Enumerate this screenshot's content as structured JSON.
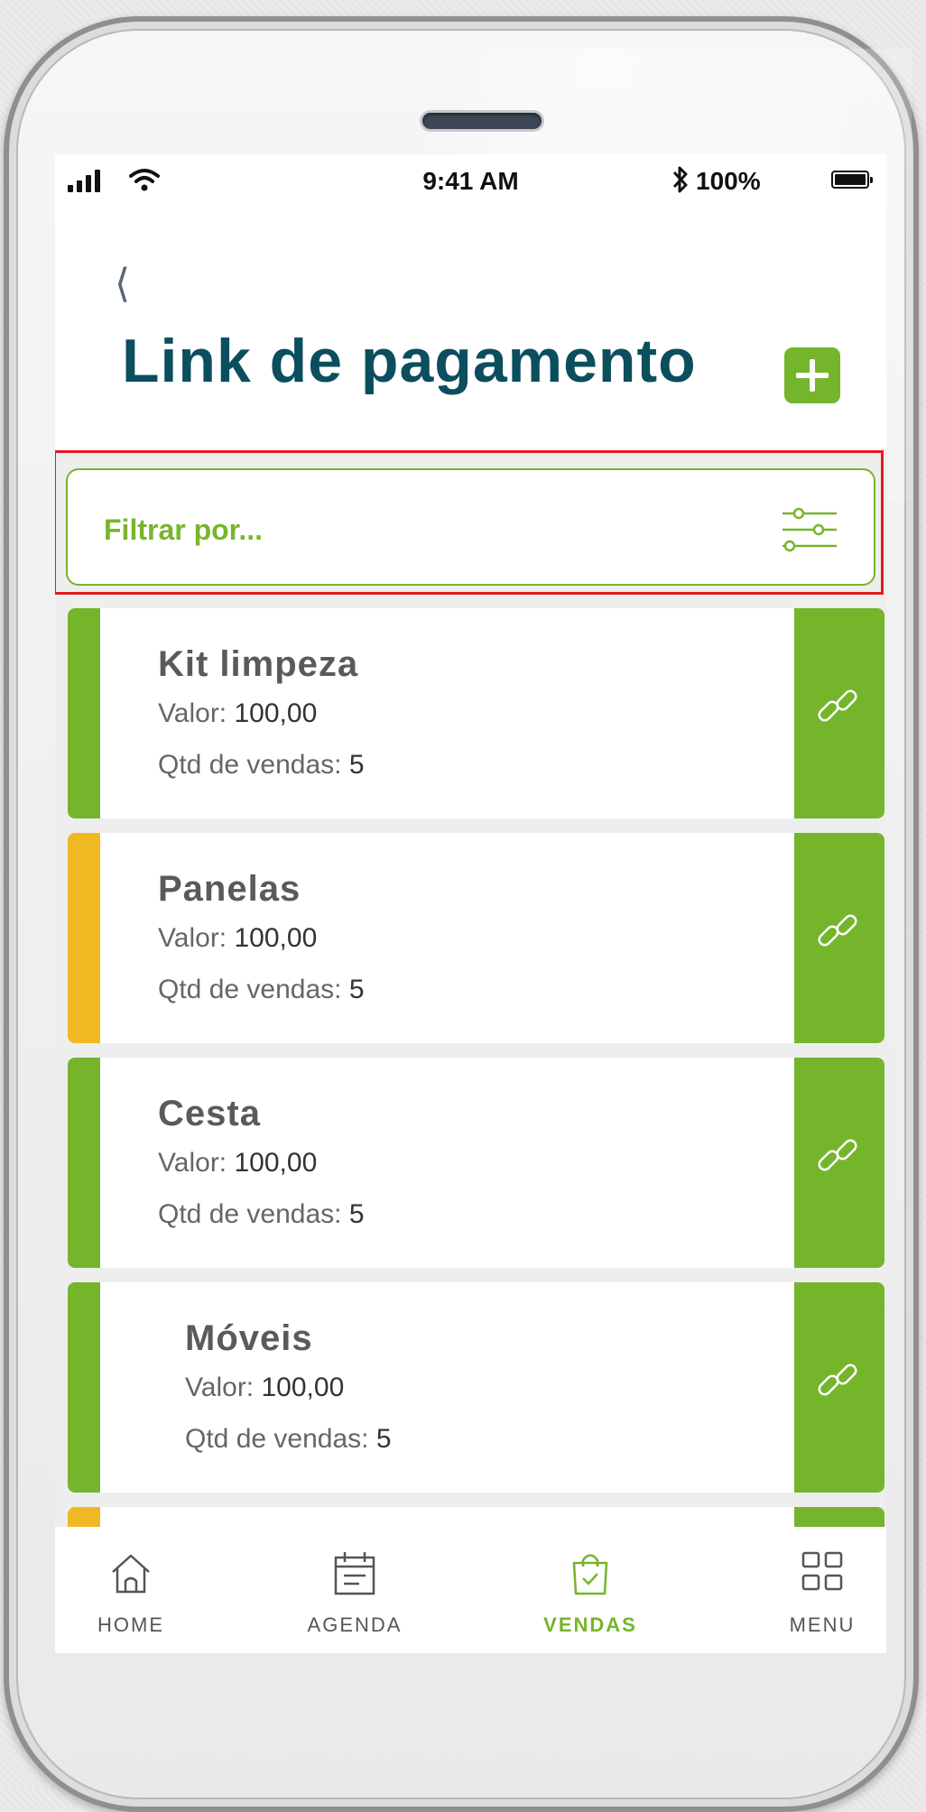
{
  "status_bar": {
    "time": "9:41 AM",
    "battery": "100%"
  },
  "header": {
    "back_icon": "chevron-left-icon",
    "title": "Link de pagamento",
    "add_icon": "plus-icon"
  },
  "filter": {
    "label": "Filtrar por...",
    "icon": "sliders-icon"
  },
  "colors": {
    "green": "#75b52b",
    "yellow": "#f0b823",
    "title": "#0b4e5e",
    "highlight": "#e31b23"
  },
  "items": [
    {
      "name": "Kit limpeza",
      "valor_label": "Valor:",
      "valor": "100,00",
      "qtd_label": "Qtd de vendas:",
      "qtd": "5",
      "status_color": "#75b52b"
    },
    {
      "name": "Panelas",
      "valor_label": "Valor:",
      "valor": "100,00",
      "qtd_label": "Qtd de vendas:",
      "qtd": "5",
      "status_color": "#f0b823"
    },
    {
      "name": "Cesta",
      "valor_label": "Valor:",
      "valor": "100,00",
      "qtd_label": "Qtd de vendas:",
      "qtd": "5",
      "status_color": "#75b52b"
    },
    {
      "name": "Móveis",
      "valor_label": "Valor:",
      "valor": "100,00",
      "qtd_label": "Qtd de vendas:",
      "qtd": "5",
      "status_color": "#75b52b"
    }
  ],
  "nav": [
    {
      "label": "HOME",
      "icon": "home-icon",
      "active": false
    },
    {
      "label": "AGENDA",
      "icon": "calendar-icon",
      "active": false
    },
    {
      "label": "VENDAS",
      "icon": "shopping-bag-icon",
      "active": true
    },
    {
      "label": "MENU",
      "icon": "grid-icon",
      "active": false
    }
  ]
}
